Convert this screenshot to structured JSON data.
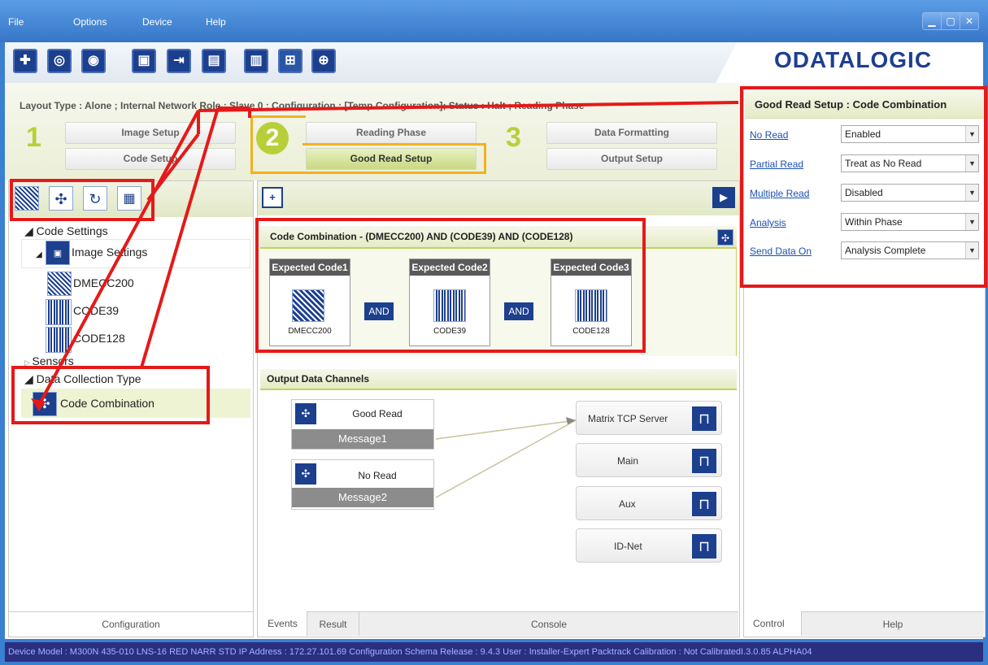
{
  "menu": [
    "File",
    "Options",
    "Device",
    "Help"
  ],
  "window_buttons": [
    "▁",
    "▢",
    "✕"
  ],
  "brand": "ODATALOGIC",
  "layout_text": "Layout Type : Alone ; Internal Network Role : Slave 0 ; Configuration : [Temp Configuration]; Status : Halt ; Reading Phase",
  "steps": {
    "n1": "1",
    "n2": "2",
    "n3": "3",
    "image_setup": "Image Setup",
    "code_setup": "Code Setup",
    "reading_phase": "Reading Phase",
    "good_read_setup": "Good Read Setup",
    "data_formatting": "Data Formatting",
    "output_setup": "Output Setup"
  },
  "tree": {
    "code_settings": "Code Settings",
    "image_settings": "Image Settings",
    "dmecc": "DMECC200",
    "code39": "CODE39",
    "code128": "CODE128",
    "sensors": "Sensors",
    "data_collection": "Data Collection Type",
    "code_combination": "Code Combination"
  },
  "left_tab": "Configuration",
  "combo": {
    "title": "Code Combination  -  (DMECC200) AND (CODE39) AND (CODE128)",
    "c1": "Expected Code1",
    "c2": "Expected Code2",
    "c3": "Expected Code3",
    "n1": "DMECC200",
    "n2": "CODE39",
    "n3": "CODE128",
    "and": "AND"
  },
  "output": {
    "title": "Output Data Channels",
    "ev1": "Good Read",
    "msg1": "Message1",
    "ev2": "No Read",
    "msg2": "Message2",
    "ch1": "Matrix TCP Server",
    "ch2": "Main",
    "ch3": "Aux",
    "ch4": "ID-Net"
  },
  "center_tabs": {
    "events": "Events",
    "result": "Result",
    "console": "Console"
  },
  "right": {
    "title": "Good Read Setup : Code Combination",
    "r1": "No Read",
    "v1": "Enabled",
    "r2": "Partial Read",
    "v2": "Treat as No Read",
    "r3": "Multiple Read",
    "v3": "Disabled",
    "r4": "Analysis",
    "v4": "Within Phase",
    "r5": "Send Data On",
    "v5": "Analysis Complete"
  },
  "right_tabs": {
    "control": "Control",
    "help": "Help"
  },
  "status": "Device Model : M300N  435-010  LNS-16 RED NARR STD   IP Address : 172.27.101.69   Configuration Schema Release : 9.4.3   User : Installer-Expert   Packtrack Calibration : Not CalibratedI.3.0.85 ALPHA04"
}
